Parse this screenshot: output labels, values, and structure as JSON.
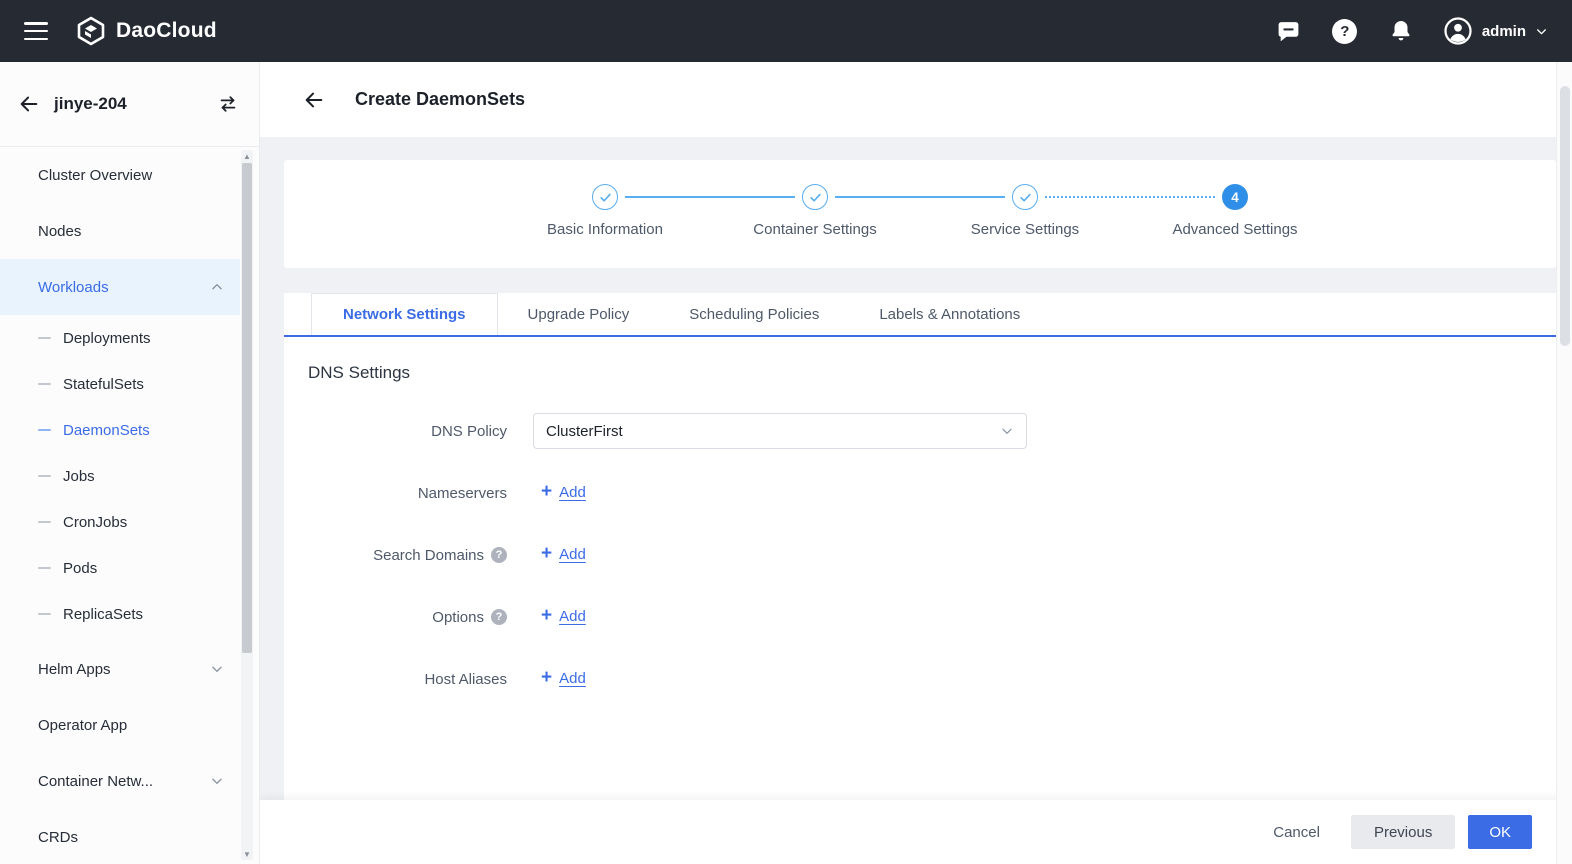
{
  "topbar": {
    "brand": "DaoCloud",
    "user": "admin"
  },
  "sidebar": {
    "cluster": "jinye-204",
    "items": [
      {
        "label": "Cluster Overview"
      },
      {
        "label": "Nodes"
      },
      {
        "label": "Workloads"
      },
      {
        "label": "Deployments"
      },
      {
        "label": "StatefulSets"
      },
      {
        "label": "DaemonSets"
      },
      {
        "label": "Jobs"
      },
      {
        "label": "CronJobs"
      },
      {
        "label": "Pods"
      },
      {
        "label": "ReplicaSets"
      },
      {
        "label": "Helm Apps"
      },
      {
        "label": "Operator App"
      },
      {
        "label": "Container Netw..."
      },
      {
        "label": "CRDs"
      }
    ]
  },
  "page": {
    "title": "Create DaemonSets"
  },
  "stepper": {
    "steps": [
      {
        "label": "Basic Information",
        "state": "done"
      },
      {
        "label": "Container Settings",
        "state": "done"
      },
      {
        "label": "Service Settings",
        "state": "done"
      },
      {
        "label": "Advanced Settings",
        "state": "current",
        "number": "4"
      }
    ]
  },
  "tabs": [
    {
      "label": "Network Settings",
      "active": true
    },
    {
      "label": "Upgrade Policy",
      "active": false
    },
    {
      "label": "Scheduling Policies",
      "active": false
    },
    {
      "label": "Labels & Annotations",
      "active": false
    }
  ],
  "form": {
    "section_title": "DNS Settings",
    "dns_policy": {
      "label": "DNS Policy",
      "value": "ClusterFirst"
    },
    "rows": [
      {
        "label": "Nameservers",
        "action": "Add",
        "help": false
      },
      {
        "label": "Search Domains",
        "action": "Add",
        "help": true
      },
      {
        "label": "Options",
        "action": "Add",
        "help": true
      },
      {
        "label": "Host Aliases",
        "action": "Add",
        "help": false
      }
    ]
  },
  "footer": {
    "cancel": "Cancel",
    "previous": "Previous",
    "ok": "OK"
  },
  "icons": {
    "question": "?",
    "plus": "+"
  },
  "colors": {
    "accent": "#3b6ce6",
    "topbar_bg": "#262b33",
    "stepper_done": "#58aef0",
    "stepper_current": "#2f8fe8",
    "active_item_bg": "#e9f3fd"
  }
}
